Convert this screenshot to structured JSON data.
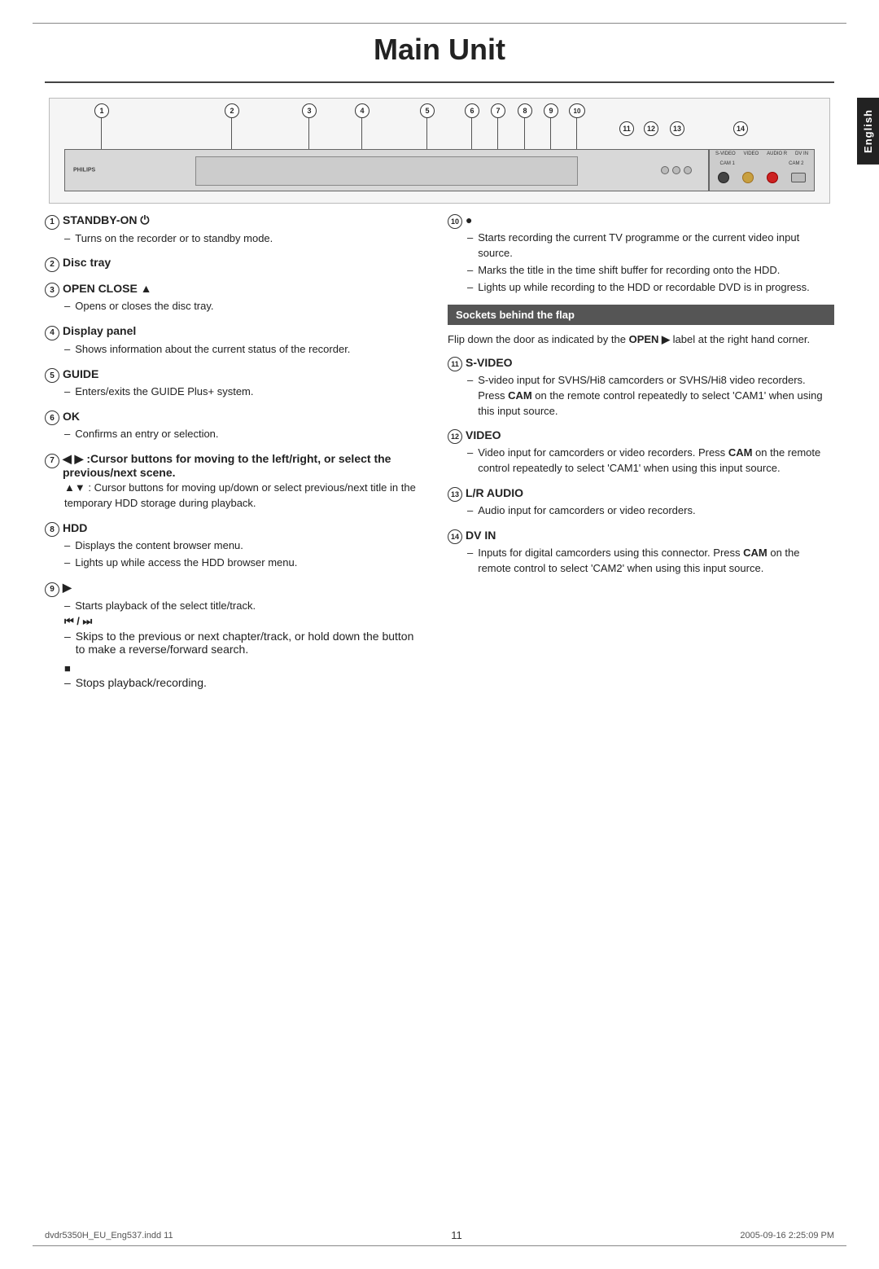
{
  "page": {
    "title": "Main Unit",
    "language_tab": "English",
    "page_number": "11",
    "footer_left": "dvdr5350H_EU_Eng537.indd  11",
    "footer_right": "2005-09-16  2:25:09 PM"
  },
  "diagram": {
    "numbers": [
      "1",
      "2",
      "3",
      "4",
      "5",
      "6",
      "7",
      "8",
      "9",
      "10",
      "11",
      "12",
      "13",
      "14"
    ],
    "labels": {
      "svideo": "S-VIDEO",
      "video": "VIDEO",
      "audio": "AUDIO R",
      "cam1": "CAM 1",
      "cam2": "CAM 2",
      "dv_in": "DV IN"
    }
  },
  "sections_left": [
    {
      "num": "1",
      "title": "STANDBY-ON",
      "symbol": "⏻",
      "bullets": [
        "Turns on the recorder or to standby mode."
      ]
    },
    {
      "num": "2",
      "title": "Disc tray",
      "bullets": []
    },
    {
      "num": "3",
      "title": "OPEN CLOSE ▲",
      "bullets": [
        "Opens or closes the disc tray."
      ]
    },
    {
      "num": "4",
      "title": "Display panel",
      "bullets": [
        "Shows information about the current status of the recorder."
      ]
    },
    {
      "num": "5",
      "title": "GUIDE",
      "bullets": [
        "Enters/exits the GUIDE Plus+ system."
      ]
    },
    {
      "num": "6",
      "title": "OK",
      "bullets": [
        "Confirms an entry or selection."
      ]
    },
    {
      "num": "7",
      "title": "◀ ▶ :Cursor buttons for moving to the left/right, or select the previous/next scene.",
      "bullets": [],
      "extra": "▲▼ : Cursor buttons for moving up/down or select previous/next title in the temporary HDD storage during playback."
    },
    {
      "num": "8",
      "title": "HDD",
      "bullets": [
        "Displays the content browser menu.",
        "Lights up while access the HDD browser menu."
      ]
    },
    {
      "num": "9",
      "title": "▶",
      "bullets": [
        "Starts playback of the select title/track."
      ],
      "sub": {
        "title": "⏮ / ⏭",
        "bullets": [
          "Skips to the previous or next chapter/track, or hold down the button to make a reverse/forward search."
        ]
      },
      "sub2": {
        "title": "■",
        "bullets": [
          "Stops playback/recording."
        ]
      }
    }
  ],
  "sections_right": [
    {
      "num": "10",
      "title": "●",
      "bullets": [
        "Starts recording the current TV programme or the current video input source.",
        "Marks the title in the time shift buffer for recording onto the HDD.",
        "Lights up while recording to the HDD or recordable DVD is in progress."
      ]
    },
    {
      "sockets_header": "Sockets behind the flap",
      "sockets_intro": "Flip down the door as indicated by the OPEN ▶ label at the right hand corner."
    },
    {
      "num": "11",
      "title": "S-VIDEO",
      "bullets": [
        "S-video input for SVHS/Hi8 camcorders or SVHS/Hi8 video recorders.",
        "Press CAM on the remote control repeatedly to select 'CAM1' when using this input source."
      ]
    },
    {
      "num": "12",
      "title": "VIDEO",
      "bullets": [
        "Video input for camcorders or video recorders.",
        "Press CAM on the remote control repeatedly to select 'CAM1' when using this input source."
      ]
    },
    {
      "num": "13",
      "title": "L/R AUDIO",
      "bullets": [
        "Audio input for camcorders or video recorders."
      ]
    },
    {
      "num": "14",
      "title": "DV IN",
      "bullets": [
        "Inputs for digital camcorders using this connector.",
        "Press CAM on the remote control to select 'CAM2' when using this input source."
      ]
    }
  ]
}
